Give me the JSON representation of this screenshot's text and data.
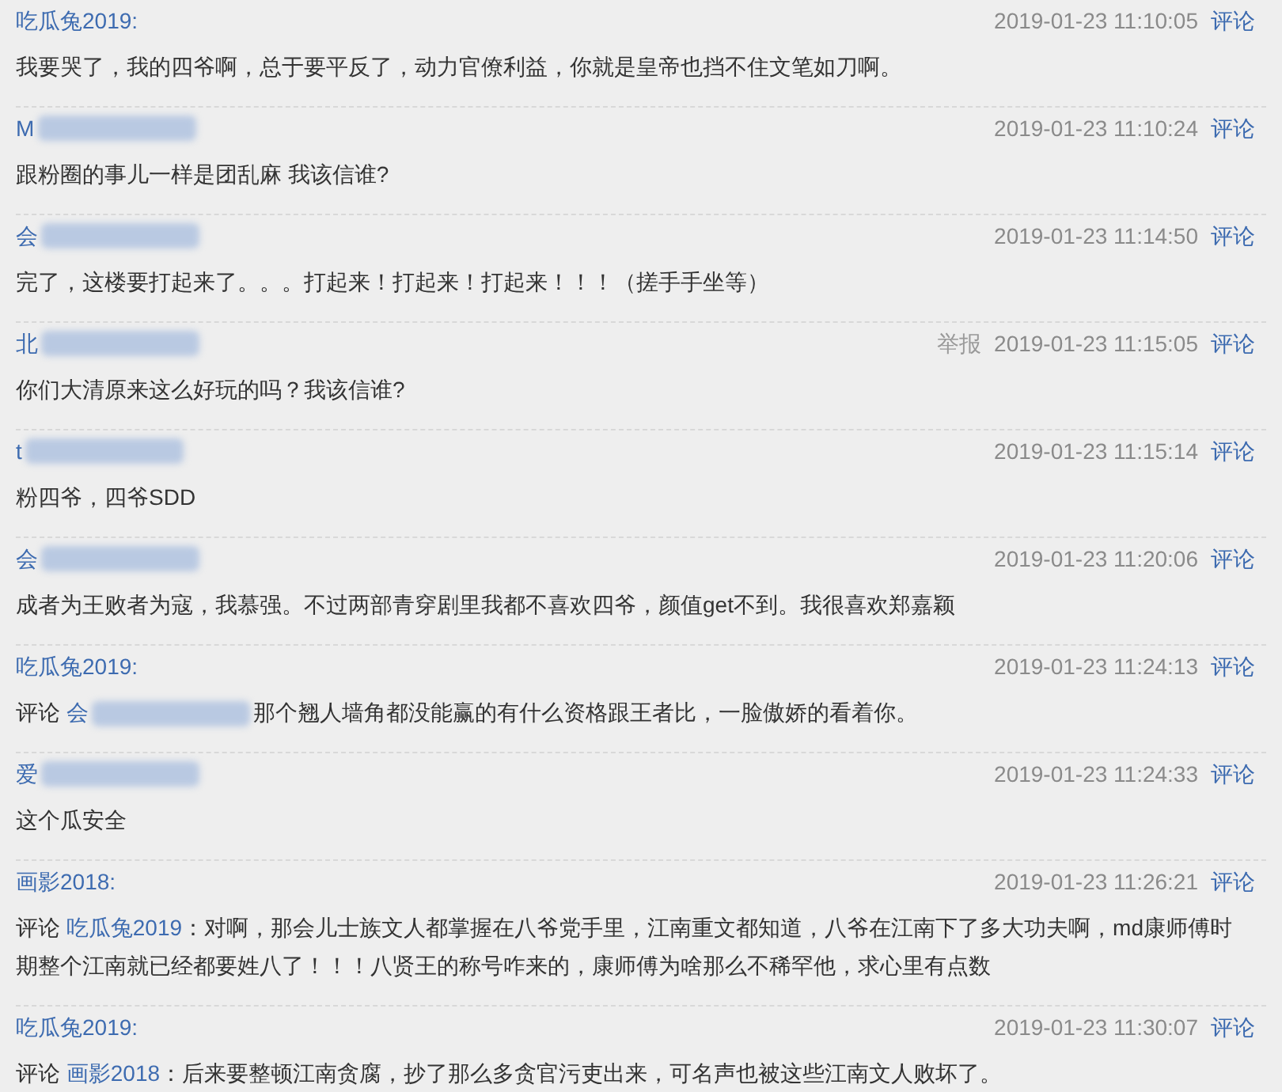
{
  "comments": [
    {
      "author": "吃瓜兔2019:",
      "author_blurred": false,
      "time": "2019-01-23 11:10:05",
      "action": "评论",
      "body": "我要哭了，我的四爷啊，总于要平反了，动力官僚利益，你就是皇帝也挡不住文笔如刀啊。"
    },
    {
      "author": "M",
      "author_blurred": true,
      "time": "2019-01-23 11:10:24",
      "action": "评论",
      "body": "跟粉圈的事儿一样是团乱麻 我该信谁?"
    },
    {
      "author": "会",
      "author_blurred": true,
      "time": "2019-01-23 11:14:50",
      "action": "评论",
      "body": "完了，这楼要打起来了。。。打起来！打起来！打起来！！！（搓手手坐等）"
    },
    {
      "author": "北",
      "author_blurred": true,
      "report": "举报",
      "time": "2019-01-23 11:15:05",
      "action": "评论",
      "body": "你们大清原来这么好玩的吗？我该信谁?"
    },
    {
      "author": "t",
      "author_blurred": true,
      "time": "2019-01-23 11:15:14",
      "action": "评论",
      "body": "粉四爷，四爷SDD"
    },
    {
      "author": "会",
      "author_blurred": true,
      "time": "2019-01-23 11:20:06",
      "action": "评论",
      "body": "成者为王败者为寇，我慕强。不过两部青穿剧里我都不喜欢四爷，颜值get不到。我很喜欢郑嘉颖"
    },
    {
      "author": "吃瓜兔2019:",
      "author_blurred": false,
      "time": "2019-01-23 11:24:13",
      "action": "评论",
      "reply": {
        "prefix": "评论",
        "name": "会",
        "name_blurred": true
      },
      "body": "那个翘人墙角都没能赢的有什么资格跟王者比，一脸傲娇的看着你。"
    },
    {
      "author": "爱",
      "author_blurred": true,
      "time": "2019-01-23 11:24:33",
      "action": "评论",
      "body": "这个瓜安全"
    },
    {
      "author": "画影2018:",
      "author_blurred": false,
      "time": "2019-01-23 11:26:21",
      "action": "评论",
      "reply": {
        "prefix": "评论",
        "name": "吃瓜兔2019",
        "name_blurred": false
      },
      "body": "：对啊，那会儿士族文人都掌握在八爷党手里，江南重文都知道，八爷在江南下了多大功夫啊，md康师傅时期整个江南就已经都要姓八了！！！八贤王的称号咋来的，康师傅为啥那么不稀罕他，求心里有点数"
    },
    {
      "author": "吃瓜兔2019:",
      "author_blurred": false,
      "time": "2019-01-23 11:30:07",
      "action": "评论",
      "reply": {
        "prefix": "评论",
        "name": "画影2018",
        "name_blurred": false
      },
      "body": "：后来要整顿江南贪腐，抄了那么多贪官污吏出来，可名声也被这些江南文人败坏了。"
    }
  ]
}
